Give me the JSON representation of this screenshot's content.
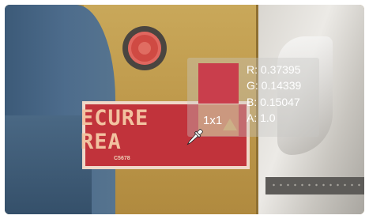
{
  "sign": {
    "line1": "ECURE",
    "line2": "REA",
    "small_text": "C5678"
  },
  "picker": {
    "swatch_color": "#c93e4c",
    "sample_size": "1x1",
    "r": "R: 0.37395",
    "g": "G: 0.14339",
    "b": "B: 0.15047",
    "a": "A: 1.0",
    "icon": "eyedropper-icon"
  },
  "colors": {
    "sign_red": "#c1333b",
    "panel_yellow": "#bf9a4c",
    "readout_text": "#ffffff"
  }
}
